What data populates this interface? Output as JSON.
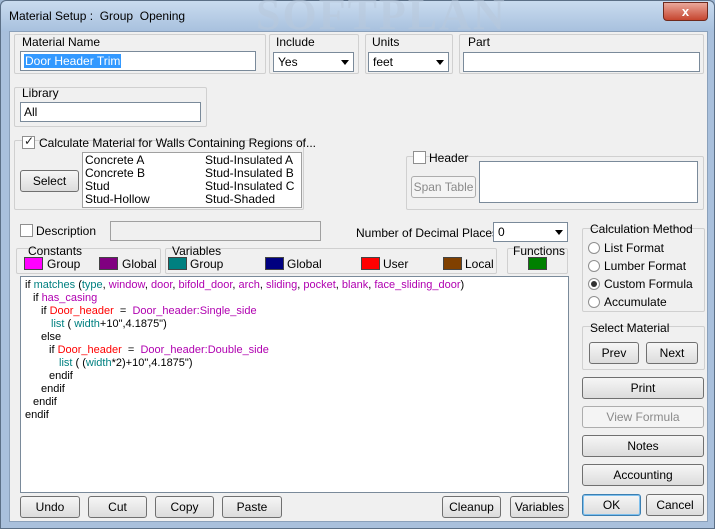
{
  "window": {
    "title": "Material Setup :  Group  Opening",
    "watermark": "SOFTPLAN",
    "close_glyph": "x"
  },
  "fields": {
    "material_name_label": "Material Name",
    "material_name_value": "Door Header Trim",
    "include_label": "Include",
    "include_value": "Yes",
    "units_label": "Units",
    "units_value": "feet",
    "part_label": "Part",
    "part_value": "",
    "library_label": "Library",
    "library_value": "All"
  },
  "calculate": {
    "label": "Calculate Material for Walls Containing Regions of...",
    "checked": true,
    "select_button": "Select",
    "regions_col1": [
      "Concrete A",
      "Concrete B",
      "Stud",
      "Stud-Hollow"
    ],
    "regions_col2": [
      "Stud-Insulated A",
      "Stud-Insulated B",
      "Stud-Insulated C",
      "Stud-Shaded"
    ]
  },
  "header": {
    "label": "Header",
    "checked": false,
    "span_table_button": "Span Table",
    "value": ""
  },
  "description": {
    "label": "Description",
    "checked": false,
    "value": ""
  },
  "decimal": {
    "label": "Number of Decimal Places",
    "value": "0"
  },
  "legend": {
    "constants_label": "Constants",
    "variables_label": "Variables",
    "functions_label": "Functions",
    "items": [
      {
        "label": "Group",
        "color": "#ff00ff"
      },
      {
        "label": "Global",
        "color": "#800080"
      },
      {
        "label": "Group",
        "color": "#008080"
      },
      {
        "label": "Global",
        "color": "#000080"
      },
      {
        "label": "User",
        "color": "#ff0000"
      },
      {
        "label": "Local",
        "color": "#804000"
      }
    ],
    "functions_color": "#008000"
  },
  "calc_method": {
    "label": "Calculation Method",
    "options": [
      {
        "label": "List Format",
        "selected": false
      },
      {
        "label": "Lumber Format",
        "selected": false
      },
      {
        "label": "Custom Formula",
        "selected": true
      },
      {
        "label": "Accumulate",
        "selected": false
      }
    ]
  },
  "select_material": {
    "label": "Select Material",
    "prev": "Prev",
    "next": "Next"
  },
  "side_buttons": {
    "print": "Print",
    "view_formula": "View Formula",
    "notes": "Notes",
    "accounting": "Accounting",
    "ok": "OK",
    "cancel": "Cancel"
  },
  "bottom_buttons": {
    "undo": "Undo",
    "cut": "Cut",
    "copy": "Copy",
    "paste": "Paste",
    "cleanup": "Cleanup",
    "variables": "Variables"
  },
  "formula": {
    "l1_if": "if ",
    "l1_matches": "matches",
    "l1_args": [
      " (",
      "type",
      ", ",
      "window",
      ", ",
      "door",
      ", ",
      "bifold_door",
      ", ",
      "arch",
      ", ",
      "sliding",
      ", ",
      "pocket",
      ", ",
      "blank",
      ", ",
      "face_sliding_door",
      ")"
    ],
    "l2_if": "if ",
    "l2_var": "has_casing",
    "l3_if": "if ",
    "l3_var": "Door_header",
    "l3_eq": "  =  ",
    "l3_val": "Door_header:Single_side",
    "l4_fn": "list",
    "l4_open": " ( ",
    "l4_var": "width",
    "l4_rest": "+10\",4.1875\")",
    "l5": "else",
    "l6_if": "if ",
    "l6_var": "Door_header",
    "l6_eq": "  =  ",
    "l6_val": "Door_header:Double_side",
    "l7_fn": "list",
    "l7_open": " ( (",
    "l7_var": "width",
    "l7_rest": "*2)+10\",4.1875\")",
    "l8": "endif",
    "l9": "endif",
    "l10": "endif",
    "l11": "endif"
  }
}
